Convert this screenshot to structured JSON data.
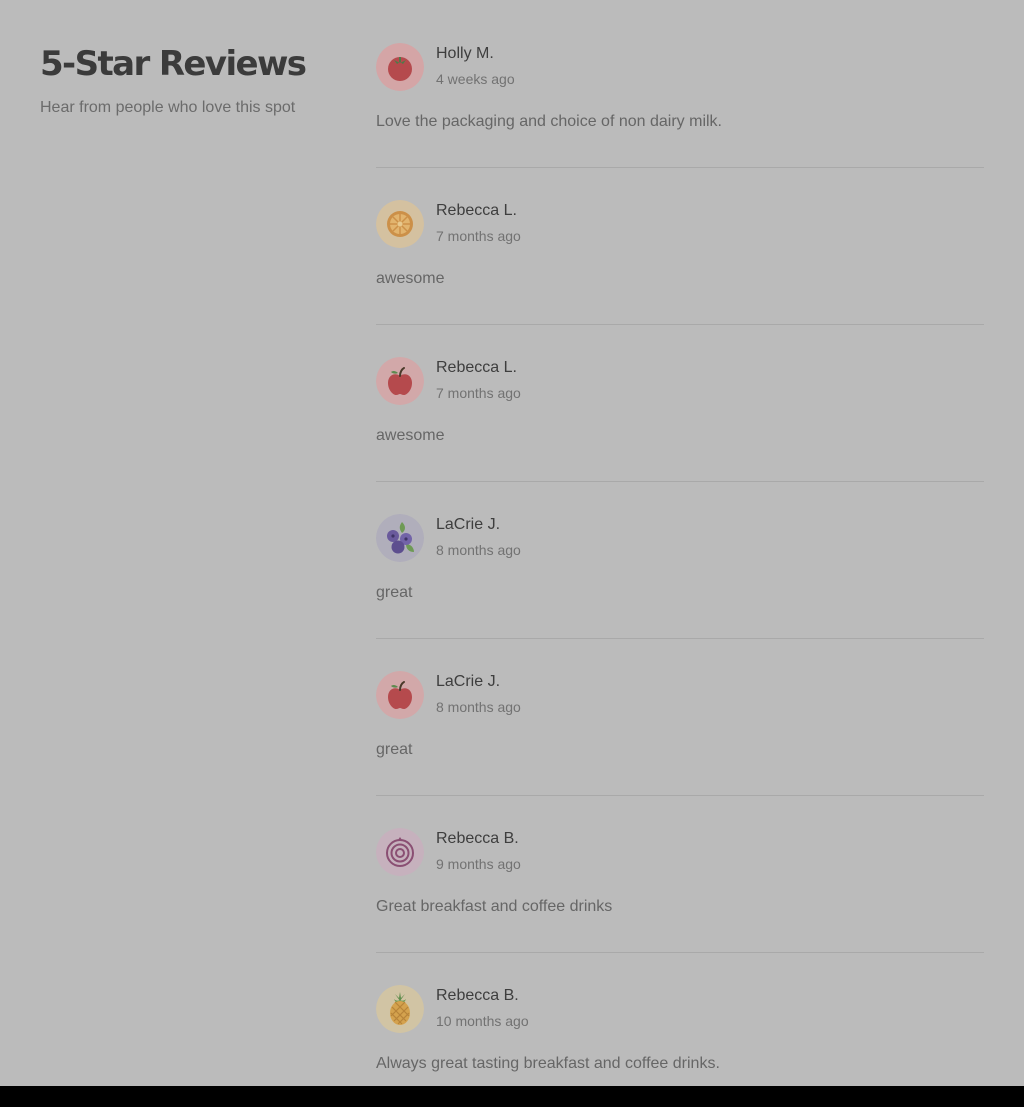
{
  "header": {
    "title": "5-Star Reviews",
    "subtitle": "Hear from people who love this spot"
  },
  "reviews": [
    {
      "name": "Holly M.",
      "time": "4 weeks ago",
      "text": "Love the packaging and choice of non dairy milk.",
      "avatar_icon": "tomato-icon"
    },
    {
      "name": "Rebecca L.",
      "time": "7 months ago",
      "text": "awesome",
      "avatar_icon": "orange-slice-icon"
    },
    {
      "name": "Rebecca L.",
      "time": "7 months ago",
      "text": "awesome",
      "avatar_icon": "apple-icon"
    },
    {
      "name": "LaCrie J.",
      "time": "8 months ago",
      "text": "great",
      "avatar_icon": "blueberries-icon"
    },
    {
      "name": "LaCrie J.",
      "time": "8 months ago",
      "text": "great",
      "avatar_icon": "apple-icon"
    },
    {
      "name": "Rebecca B.",
      "time": "9 months ago",
      "text": "Great breakfast and coffee drinks",
      "avatar_icon": "onion-icon"
    },
    {
      "name": "Rebecca B.",
      "time": "10 months ago",
      "text": "Always great tasting breakfast and coffee drinks.",
      "avatar_icon": "pineapple-icon"
    }
  ],
  "colors": {
    "background": "#bbbbbb",
    "heading": "#3b3b3b",
    "body_text": "#666666",
    "meta_text": "#727272",
    "divider": "#a9a9a9"
  }
}
